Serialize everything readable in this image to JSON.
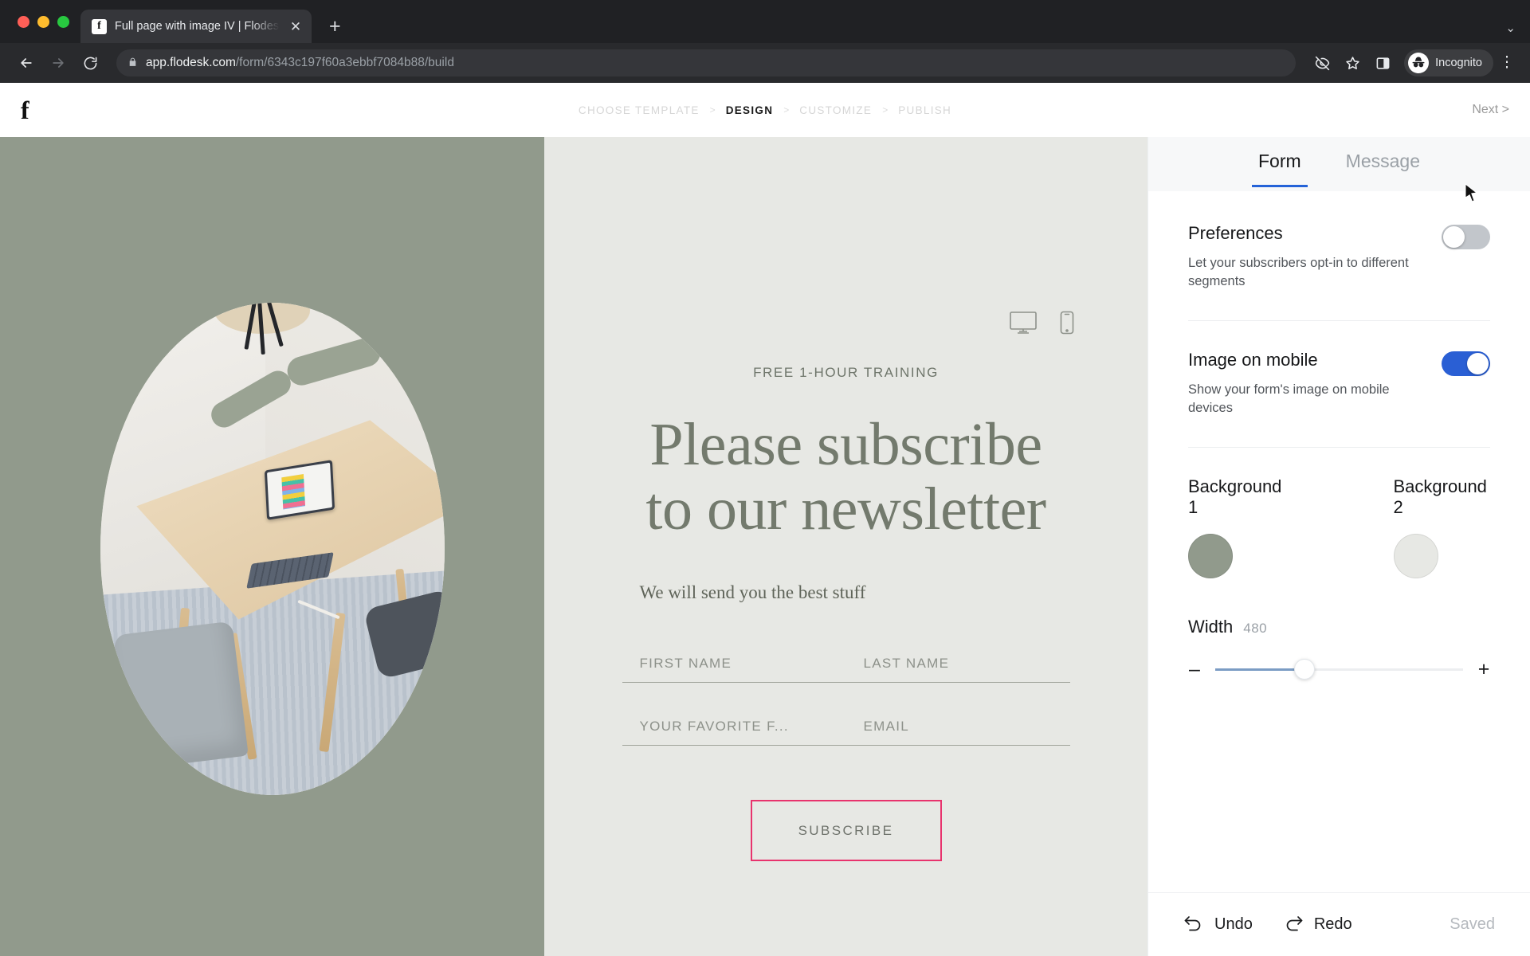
{
  "browser": {
    "tab": {
      "title": "Full page with image IV | Flodesk",
      "favicon_icon": "flodesk-f-icon",
      "close_icon": "close-icon"
    },
    "new_tab_icon": "plus-icon",
    "tabstrip_chevron_icon": "chevron-down-icon",
    "nav": {
      "back_icon": "arrow-back-icon",
      "forward_icon": "arrow-forward-icon",
      "reload_icon": "reload-icon"
    },
    "omnibox": {
      "lock_icon": "lock-icon",
      "url_host": "app.flodesk.com",
      "url_path": "/form/6343c197f60a3ebbf7084b88/build"
    },
    "toolbar_icons": [
      "eye-slash-icon",
      "star-icon",
      "side-panel-icon"
    ],
    "incognito": {
      "label": "Incognito",
      "avatar_icon": "incognito-avatar-icon"
    },
    "menu_icon": "kebab-menu-icon"
  },
  "app": {
    "logo_text": "f",
    "steps": [
      {
        "label": "CHOOSE TEMPLATE",
        "active": false
      },
      {
        "label": "DESIGN",
        "active": true
      },
      {
        "label": "CUSTOMIZE",
        "active": false
      },
      {
        "label": "PUBLISH",
        "active": false
      }
    ],
    "step_separator": ">",
    "next_label": "Next  >"
  },
  "canvas": {
    "device_desktop_icon": "desktop-monitor-icon",
    "device_mobile_icon": "mobile-phone-icon",
    "eyebrow": "FREE 1-HOUR TRAINING",
    "headline": "Please subscribe to our newsletter",
    "subcopy": "We will send you the best stuff",
    "fields": [
      {
        "placeholder": "FIRST NAME"
      },
      {
        "placeholder": "LAST NAME"
      },
      {
        "placeholder": "YOUR FAVORITE F..."
      },
      {
        "placeholder": "EMAIL"
      }
    ],
    "subscribe_label": "SUBSCRIBE",
    "subscribe_border_color": "#e8336d",
    "background_color": "#e7e8e4",
    "image_panel_color": "#919a8c",
    "headline_color": "#737a6d"
  },
  "sidebar": {
    "tabs": [
      {
        "label": "Form",
        "active": true
      },
      {
        "label": "Message",
        "active": false
      }
    ],
    "active_tab_underline_color": "#2563d8",
    "preferences": {
      "title": "Preferences",
      "description": "Let your subscribers opt-in to different segments",
      "enabled": false
    },
    "image_on_mobile": {
      "title": "Image on mobile",
      "description": "Show your form's image on mobile devices",
      "enabled": true,
      "on_color": "#2a5fd4"
    },
    "backgrounds": [
      {
        "label": "Background 1",
        "color": "#919a8c"
      },
      {
        "label": "Background 2",
        "color": "#e7e8e4"
      }
    ],
    "width": {
      "label": "Width",
      "value": "480",
      "minus_label": "–",
      "plus_label": "+",
      "percent": 36
    },
    "footer": {
      "undo_label": "Undo",
      "undo_icon": "undo-arrow-icon",
      "redo_label": "Redo",
      "redo_icon": "redo-arrow-icon",
      "status": "Saved"
    }
  }
}
